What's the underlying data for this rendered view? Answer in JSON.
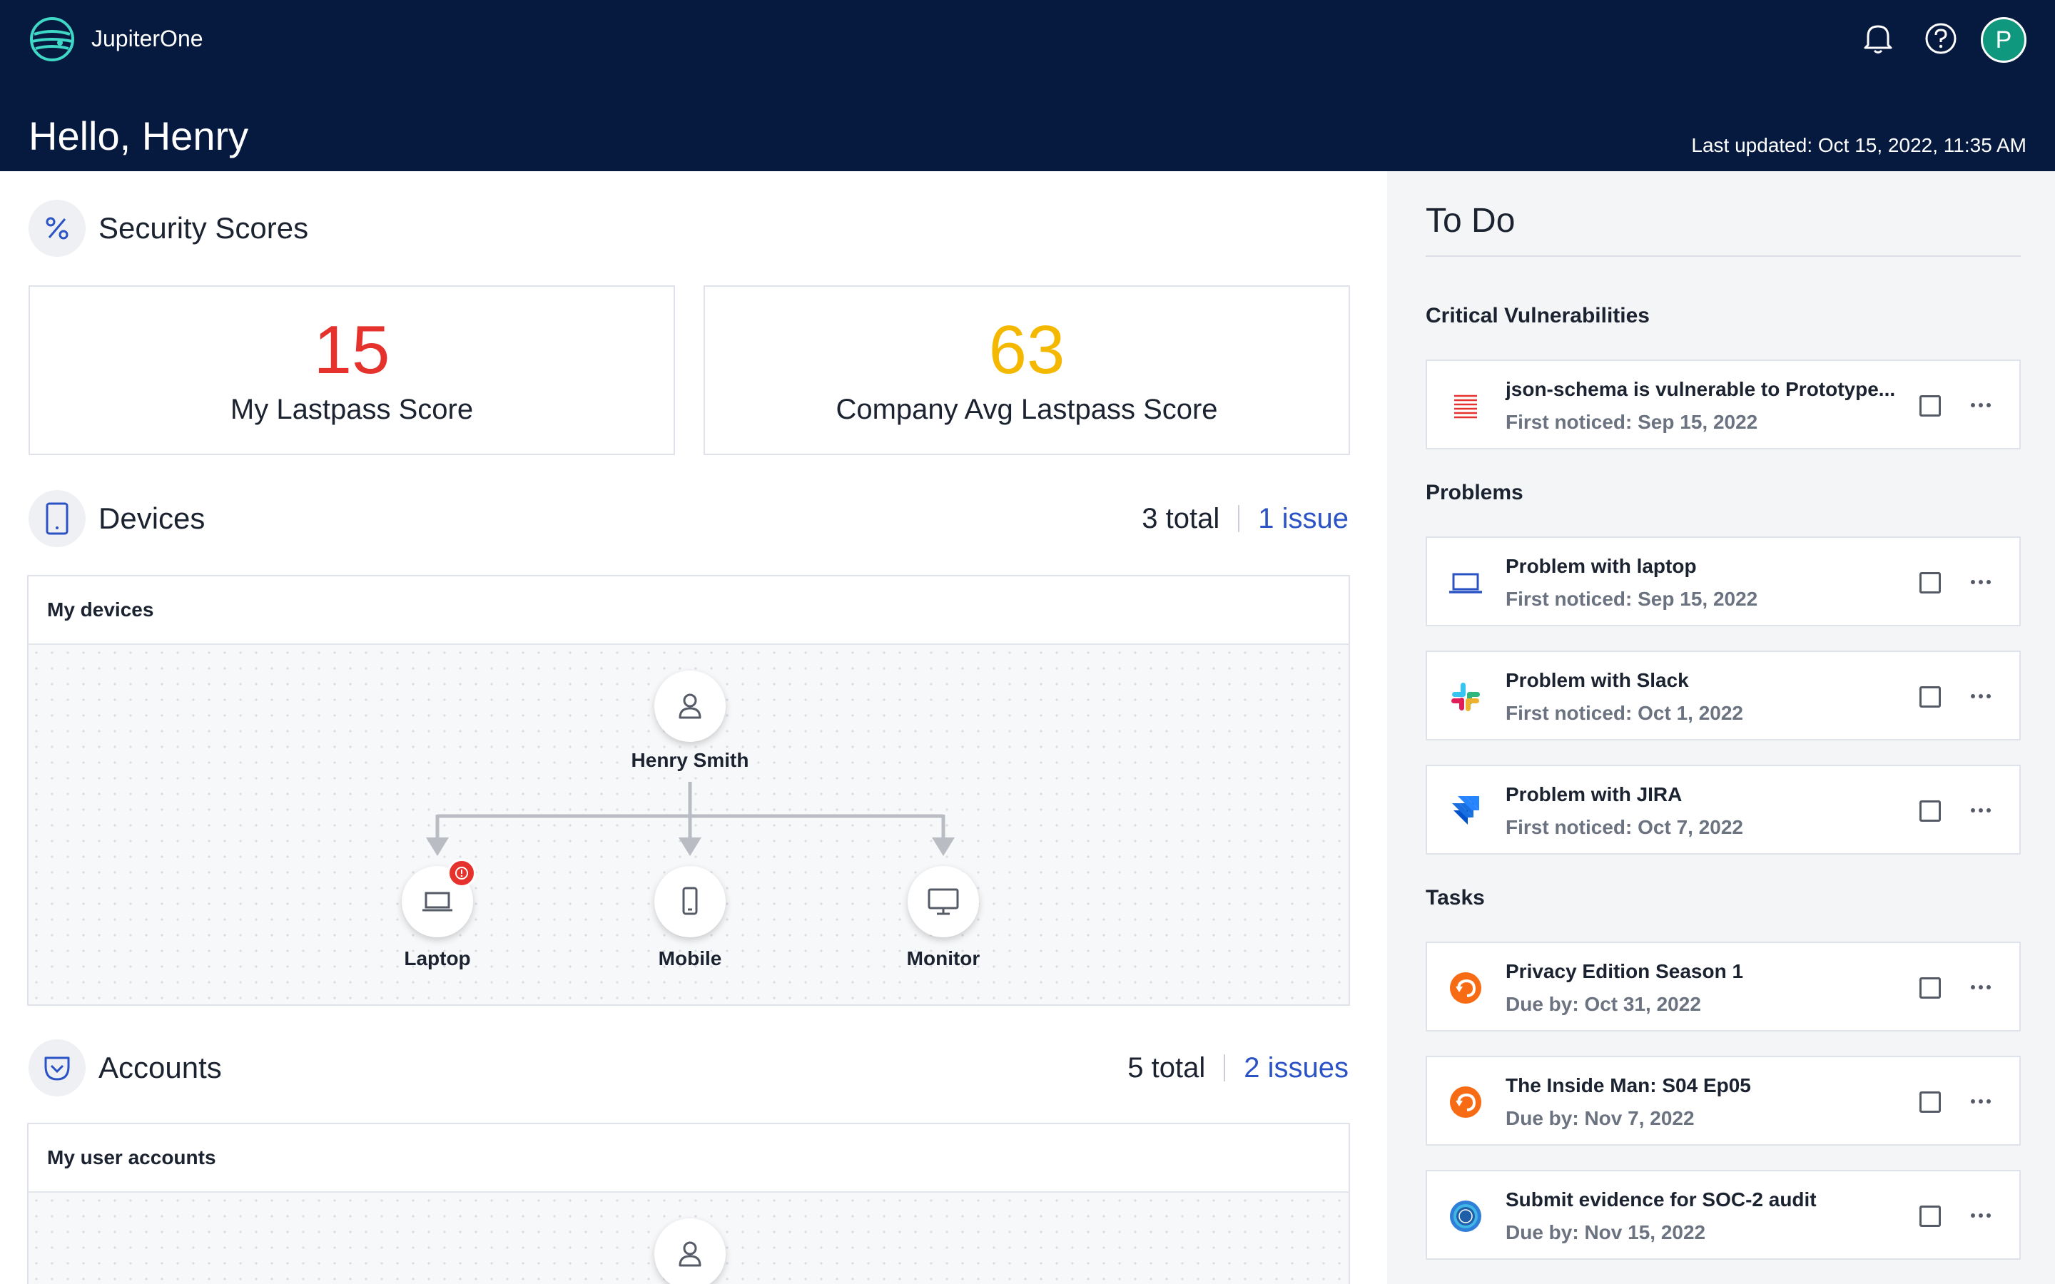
{
  "header": {
    "brand": "JupiterOne",
    "greeting": "Hello, Henry",
    "last_updated": "Last updated: Oct 15, 2022, 11:35 AM",
    "avatar_initial": "P",
    "icons": [
      "bell-icon",
      "help-icon"
    ]
  },
  "security_scores": {
    "title": "Security Scores",
    "icon": "percent-icon",
    "my_score": {
      "value": "15",
      "label": "My Lastpass Score",
      "color": "#e5322d"
    },
    "company_score": {
      "value": "63",
      "label": "Company Avg Lastpass Score",
      "color": "#f5b800"
    }
  },
  "devices": {
    "title": "Devices",
    "icon": "tablet-icon",
    "total": "3 total",
    "issues": "1 issue",
    "panel_title": "My devices",
    "user": "Henry Smith",
    "nodes": [
      {
        "label": "Laptop",
        "icon": "laptop-icon",
        "alert": true
      },
      {
        "label": "Mobile",
        "icon": "mobile-icon",
        "alert": false
      },
      {
        "label": "Monitor",
        "icon": "monitor-icon",
        "alert": false
      }
    ]
  },
  "accounts": {
    "title": "Accounts",
    "icon": "pocket-icon",
    "total": "5 total",
    "issues": "2 issues",
    "panel_title": "My user accounts"
  },
  "todo": {
    "title": "To Do",
    "critical": {
      "title": "Critical Vulnerabilities",
      "items": [
        {
          "name": "json-schema is vulnerable to Prototype...",
          "sub": "First noticed: Sep 15, 2022",
          "icon": "vulnerability-list-icon"
        }
      ]
    },
    "problems": {
      "title": "Problems",
      "items": [
        {
          "name": "Problem with laptop",
          "sub": "First noticed: Sep 15, 2022",
          "icon": "laptop-icon"
        },
        {
          "name": "Problem with Slack",
          "sub": "First noticed: Oct 1, 2022",
          "icon": "slack-icon"
        },
        {
          "name": "Problem with JIRA",
          "sub": "First noticed: Oct 7, 2022",
          "icon": "jira-icon"
        }
      ]
    },
    "tasks": {
      "title": "Tasks",
      "items": [
        {
          "name": "Privacy Edition Season 1",
          "sub": "Due by: Oct 31, 2022",
          "icon": "training-icon"
        },
        {
          "name": "The Inside Man: S04 Ep05",
          "sub": "Due by: Nov 7, 2022",
          "icon": "training-icon"
        },
        {
          "name": "Submit evidence for SOC-2 audit",
          "sub": "Due by: Nov 15, 2022",
          "icon": "soc2-badge-icon"
        }
      ]
    }
  },
  "colors": {
    "header_bg": "#061a40",
    "accent_blue": "#2b53c5",
    "avatar": "#10987f",
    "alert_red": "#e5322d",
    "score_yellow": "#f5b800"
  }
}
